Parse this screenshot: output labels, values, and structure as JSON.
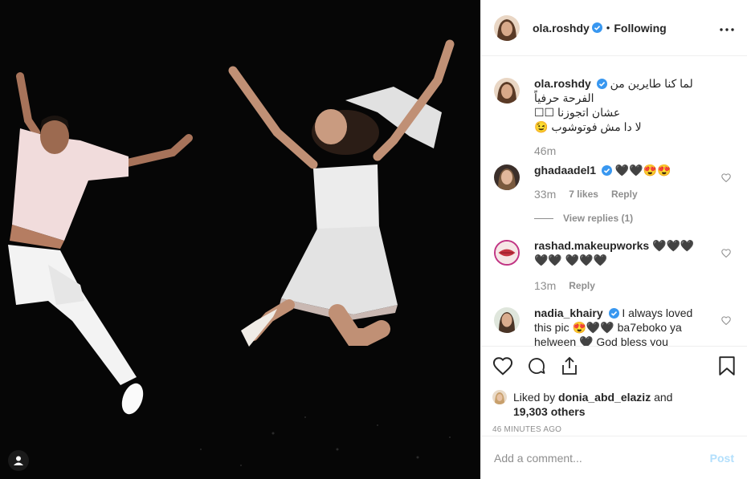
{
  "post": {
    "author": "ola.roshdy",
    "follow_status": "Following",
    "separator": "•"
  },
  "caption": {
    "user": "ola.roshdy",
    "line1": "لما كنا طايرين من الفرحة حرفياً",
    "line2": "عشان اتجوزنا ☐☐",
    "line3": "لا دا مش فوتوشوب 😉",
    "time": "46m"
  },
  "comments": [
    {
      "user": "ghadaadel1",
      "verified": true,
      "text": "🖤🖤😍😍",
      "time": "33m",
      "likes": "7 likes",
      "reply": "Reply",
      "view_replies": "View replies (1)"
    },
    {
      "user": "rashad.makeupworks",
      "verified": false,
      "text": "🖤🖤🖤🖤🖤 🖤🖤🖤",
      "time": "13m",
      "reply": "Reply"
    },
    {
      "user": "nadia_khairy",
      "verified": true,
      "text": "I always loved this pic 😍🖤🖤 ba7eboko ya helween 🖤 God bless you"
    }
  ],
  "likes": {
    "prefix": "Liked by",
    "user": "donia_abd_elaziz",
    "and": "and",
    "count": "19,303 others"
  },
  "timestamp": "46 MINUTES AGO",
  "add_comment": {
    "placeholder": "Add a comment...",
    "post_label": "Post"
  },
  "icons": [
    "user-tag-icon",
    "verified-icon",
    "more-icon",
    "heart-icon",
    "comment-icon",
    "share-icon",
    "bookmark-icon"
  ],
  "colors": {
    "verified": "#3897f0",
    "post_disabled": "#b2dffc",
    "muted": "#8e8e8e"
  }
}
